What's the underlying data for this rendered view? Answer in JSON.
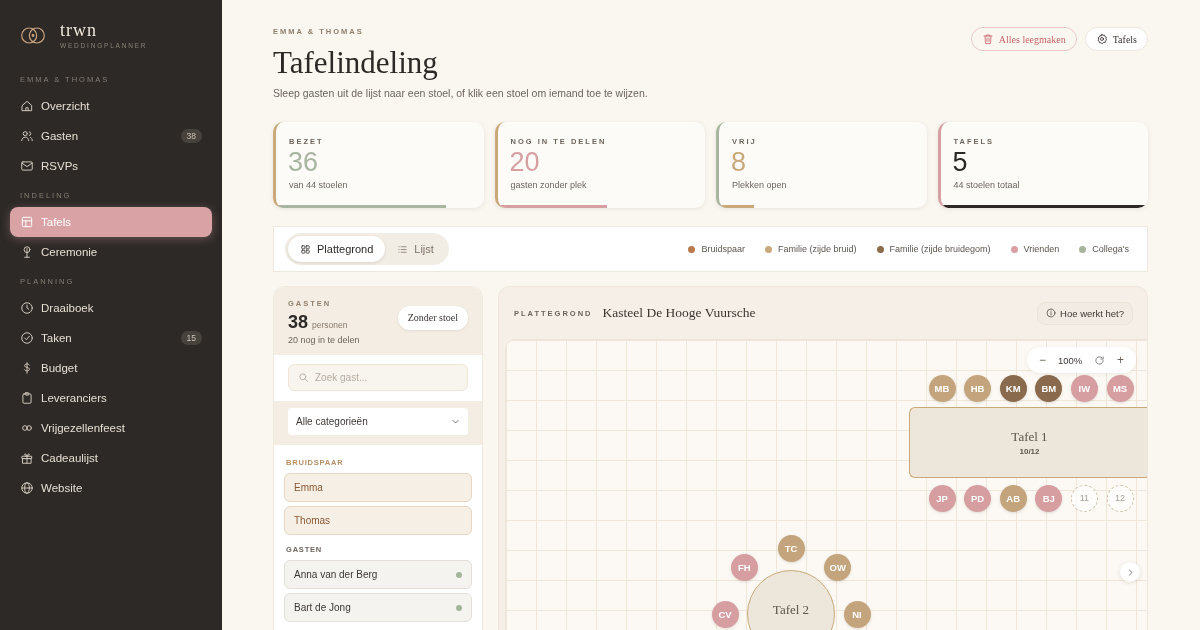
{
  "sidebar": {
    "brand": {
      "name": "trwn",
      "tagline": "WEDDINGPLANNER"
    },
    "sections": [
      {
        "title": "EMMA & THOMAS",
        "items": [
          {
            "label": "Overzicht",
            "selected": false
          },
          {
            "label": "Gasten",
            "badge": "38",
            "selected": false
          },
          {
            "label": "RSVPs",
            "selected": false
          }
        ]
      },
      {
        "title": "INDELING",
        "items": [
          {
            "label": "Tafels",
            "selected": true
          },
          {
            "label": "Ceremonie",
            "selected": false
          }
        ]
      },
      {
        "title": "PLANNING",
        "items": [
          {
            "label": "Draaiboek",
            "selected": false
          },
          {
            "label": "Taken",
            "badge": "15",
            "selected": false
          },
          {
            "label": "Budget",
            "selected": false
          },
          {
            "label": "Leveranciers",
            "selected": false
          },
          {
            "label": "Vrijgezellenfeest",
            "selected": false
          },
          {
            "label": "Cadeaulijst",
            "selected": false
          },
          {
            "label": "Website",
            "selected": false
          }
        ]
      }
    ]
  },
  "header": {
    "eyebrow": "EMMA & THOMAS",
    "title": "Tafelindeling",
    "subtitle": "Sleep gasten uit de lijst naar een stoel, of klik een stoel om iemand toe te wijzen.",
    "buttons": [
      {
        "label": "Alles leegmaken",
        "kind": "danger"
      },
      {
        "label": "Tafels",
        "kind": "plain"
      }
    ]
  },
  "stats": [
    {
      "label": "BEZET",
      "value": "36",
      "caption": "van 44 stoelen",
      "level": 0.82,
      "color": "#a9b5a1",
      "edge": {
        "color": "#c9a97a"
      }
    },
    {
      "label": "NOG IN TE DELEN",
      "value": "20",
      "caption": "gasten zonder plek",
      "level": 0.53,
      "color": "#d6a0a3",
      "edge": {
        "color": "#c9a97a"
      }
    },
    {
      "label": "VRIJ",
      "value": "8",
      "caption": "Plekken open",
      "level": 0.17,
      "color": "#c9a97a",
      "edge": {
        "color": "#a9b5a1"
      }
    },
    {
      "label": "TAFELS",
      "value": "5",
      "caption": "44 stoelen totaal",
      "level": 1,
      "color": "#2d2926",
      "edge": {
        "color": "#d6a0a3"
      }
    }
  ],
  "view_toggle": [
    {
      "label": "Plattegrond",
      "selected": true
    },
    {
      "label": "Lijst",
      "selected": false
    }
  ],
  "legend": [
    {
      "label": "Bruidspaar",
      "color": "#b97a4e"
    },
    {
      "label": "Familie (zijde bruid)",
      "color": "#c9a87c"
    },
    {
      "label": "Familie (zijde bruidegom)",
      "color": "#8c6b4b"
    },
    {
      "label": "Vrienden",
      "color": "#d89ea3"
    },
    {
      "label": "Collega's",
      "color": "#a7b59f"
    }
  ],
  "guests": {
    "title": "GASTEN",
    "count": "38",
    "count_unit": "personen",
    "remaining": "20 nog in te delen",
    "filter_button": "Zonder stoel",
    "search": {
      "placeholder": "Zoek gast..."
    },
    "category_select": {
      "value": "Alle categorieën"
    },
    "groups": [
      {
        "title": "BRUIDSPAAR",
        "kind": "couple",
        "items": [
          {
            "name": "Emma"
          },
          {
            "name": "Thomas"
          }
        ]
      },
      {
        "title": "GASTEN",
        "kind": "guest",
        "items": [
          {
            "name": "Anna van der Berg",
            "color": "#a7b59f"
          },
          {
            "name": "Bart de Jong",
            "color": "#a7b59f"
          }
        ]
      }
    ]
  },
  "floorplan": {
    "eyebrow": "PLATTEGROND",
    "venue": "Kasteel De Hooge Vuursche",
    "help_button": "Hoe werkt het?",
    "zoom": {
      "minus": "−",
      "value": "100%",
      "plus": "+"
    },
    "tables": [
      {
        "kind": "rect",
        "name": "Tafel 1",
        "occupancy": "10/12",
        "seats_top": [
          {
            "label": "MB",
            "kind": "guest",
            "color": "#c4a47c"
          },
          {
            "label": "HB",
            "kind": "guest",
            "color": "#c4a47c"
          },
          {
            "label": "KM",
            "kind": "guest",
            "color": "#8a6a4c"
          },
          {
            "label": "BM",
            "kind": "guest",
            "color": "#8a6a4c"
          },
          {
            "label": "IW",
            "kind": "guest",
            "color": "#d79ea2"
          },
          {
            "label": "MS",
            "kind": "guest",
            "color": "#d79ea2"
          }
        ],
        "seats_bottom": [
          {
            "label": "JP",
            "kind": "guest",
            "color": "#d79ea2"
          },
          {
            "label": "PD",
            "kind": "guest",
            "color": "#d79ea2"
          },
          {
            "label": "AB",
            "kind": "guest",
            "color": "#c4a47c"
          },
          {
            "label": "BJ",
            "kind": "guest",
            "color": "#d79ea2"
          },
          {
            "label": "11",
            "kind": "empty"
          },
          {
            "label": "12",
            "kind": "empty"
          }
        ]
      },
      {
        "kind": "round",
        "name": "Tafel 2",
        "seats": [
          {
            "label": "CV",
            "kind": "guest",
            "color": "#d79ea2"
          },
          {
            "label": "FH",
            "kind": "guest",
            "color": "#d79ea2"
          },
          {
            "label": "TC",
            "kind": "guest",
            "color": "#c4a47c"
          },
          {
            "label": "OW",
            "kind": "guest",
            "color": "#c4a47c"
          },
          {
            "label": "NI",
            "kind": "guest",
            "color": "#c4a47c"
          }
        ]
      }
    ]
  }
}
